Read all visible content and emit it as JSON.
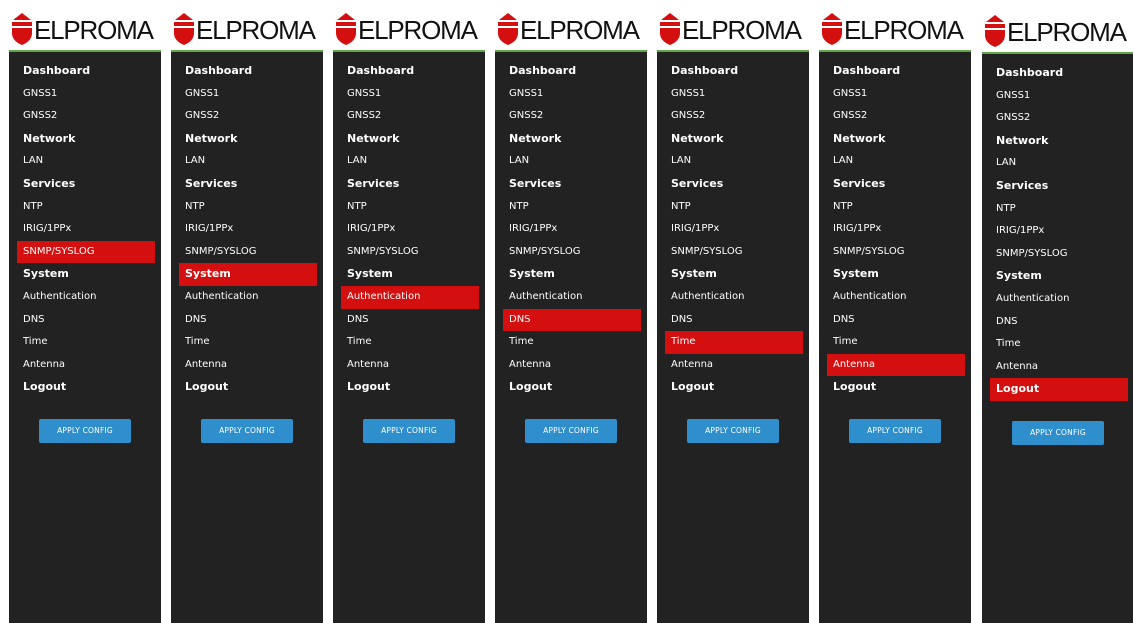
{
  "brand": {
    "name": "ELPROMA",
    "logo_color": "#d40f0f",
    "divider_color": "#5ea847"
  },
  "theme": {
    "panel_bg": "#222222",
    "selected_bg": "#d40f0f",
    "button_bg": "#2f8fcc"
  },
  "panels": [
    {
      "selected": "snmp-syslog"
    },
    {
      "selected": "system"
    },
    {
      "selected": "authentication"
    },
    {
      "selected": "dns"
    },
    {
      "selected": "time"
    },
    {
      "selected": "antenna"
    },
    {
      "selected": "logout"
    }
  ],
  "menu": {
    "dashboard": "Dashboard",
    "gnss1": "GNSS1",
    "gnss2": "GNSS2",
    "network": "Network",
    "lan": "LAN",
    "services": "Services",
    "ntp": "NTP",
    "irig": "IRIG/1PPx",
    "snmp": "SNMP/SYSLOG",
    "system": "System",
    "authentication": "Authentication",
    "dns": "DNS",
    "time": "Time",
    "antenna": "Antenna",
    "logout": "Logout"
  },
  "apply_button": {
    "label": "APPLY CONFIG"
  }
}
